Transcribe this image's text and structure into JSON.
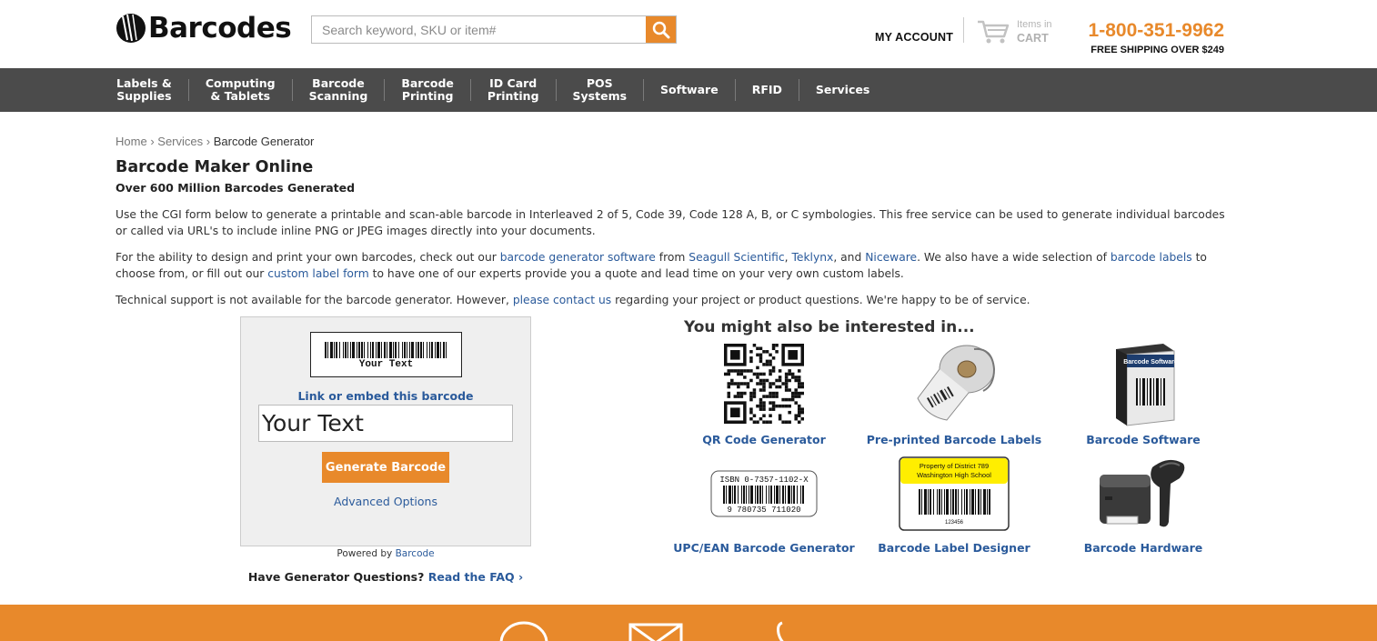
{
  "header": {
    "logo_text": "Barcodes",
    "search_placeholder": "Search keyword, SKU or item#",
    "my_account": "MY ACCOUNT",
    "cart_items": "Items in",
    "cart_label": "CART",
    "phone": "1-800-351-9962",
    "free_shipping": "FREE SHIPPING OVER $249"
  },
  "nav": {
    "items": [
      {
        "label": "Labels &\nSupplies"
      },
      {
        "label": "Computing\n& Tablets"
      },
      {
        "label": "Barcode\nScanning"
      },
      {
        "label": "Barcode\nPrinting"
      },
      {
        "label": "ID Card\nPrinting"
      },
      {
        "label": "POS\nSystems"
      },
      {
        "label": "Software"
      },
      {
        "label": "RFID"
      },
      {
        "label": "Services"
      }
    ]
  },
  "breadcrumb": {
    "home": "Home",
    "sep": "›",
    "services": "Services",
    "current": "Barcode Generator"
  },
  "page": {
    "title": "Barcode Maker Online",
    "subtitle": "Over 600 Million Barcodes Generated",
    "p1": "Use the CGI form below to generate a printable and scan-able barcode in Interleaved 2 of 5, Code 39, Code 128 A, B, or C symbologies. This free service can be used to generate individual barcodes or called via URL's to include inline PNG or JPEG images directly into your documents.",
    "p2_a": "For the ability to design and print your own barcodes, check out our ",
    "p2_link1": "barcode generator software",
    "p2_b": " from ",
    "p2_link2": "Seagull Scientific",
    "p2_c": ", ",
    "p2_link3": "Teklynx",
    "p2_d": ", and ",
    "p2_link4": "Niceware",
    "p2_e": ". We also have a wide selection of ",
    "p2_link5": "barcode labels",
    "p2_f": " to choose from, or fill out our ",
    "p2_link6": "custom label form",
    "p2_g": " to have one of our experts provide you a quote and lead time on your very own custom labels.",
    "p3_a": "Technical support is not available for the barcode generator. However, ",
    "p3_link": "please contact us",
    "p3_b": " regarding your project or product questions. We're happy to be of service."
  },
  "generator": {
    "preview_text": "Your Text",
    "link_embed": "Link or embed this barcode",
    "input_value": "Your Text",
    "button": "Generate Barcode",
    "advanced": "Advanced Options",
    "powered_by": "Powered by ",
    "powered_link": "Barcode",
    "faq_q": "Have Generator Questions? ",
    "faq_link": "Read the FAQ ›"
  },
  "interest": {
    "title": "You might also be interested in...",
    "products": [
      {
        "label": "QR Code Generator",
        "icon": "qr-code-icon"
      },
      {
        "label": "Pre-printed Barcode Labels",
        "icon": "label-roll-icon"
      },
      {
        "label": "Barcode Software",
        "icon": "software-box-icon"
      },
      {
        "label": "UPC/EAN Barcode Generator",
        "icon": "upc-barcode-icon"
      },
      {
        "label": "Barcode Label Designer",
        "icon": "label-designer-icon"
      },
      {
        "label": "Barcode Hardware",
        "icon": "printer-scanner-icon"
      }
    ],
    "upc_isbn": "ISBN 0-7357-1102-X",
    "upc_digits": "9 780735 711020",
    "designer_line1": "Property of District 789",
    "designer_line2": "Washington High School",
    "designer_num": "123456",
    "software_box_text": "Barcode Software"
  },
  "colors": {
    "accent": "#e8892b",
    "nav_bg": "#4b4b4b",
    "link": "#2a5a9b"
  }
}
